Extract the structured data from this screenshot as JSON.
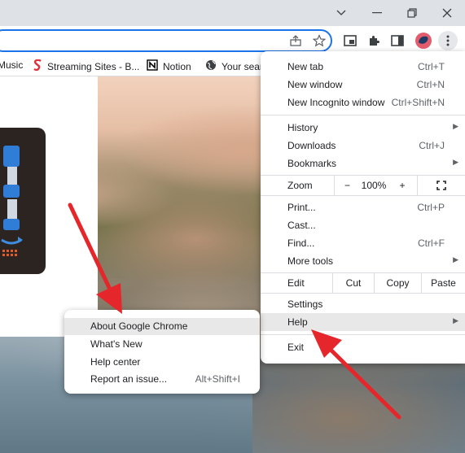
{
  "titlebar": {
    "chevron": "chevron-down-icon",
    "minimize": "minimize-icon",
    "restore": "restore-icon",
    "close": "close-icon"
  },
  "toolbar": {
    "share_icon": "share-icon",
    "star_icon": "star-icon",
    "pip_icon": "picture-in-picture-icon",
    "extensions_icon": "puzzle-icon",
    "sidepanel_icon": "side-panel-icon",
    "profile_icon": "profile-avatar-icon",
    "menu_icon": "three-dots-icon"
  },
  "bookmarks": [
    {
      "label": "Music",
      "icon": ""
    },
    {
      "label": "Streaming Sites - B...",
      "icon": "s-logo-icon"
    },
    {
      "label": "Notion",
      "icon": "notion-icon"
    },
    {
      "label": "Your sear",
      "icon": "globe-icon"
    }
  ],
  "menu": {
    "new_tab": {
      "label": "New tab",
      "shortcut": "Ctrl+T"
    },
    "new_window": {
      "label": "New window",
      "shortcut": "Ctrl+N"
    },
    "new_incognito": {
      "label": "New Incognito window",
      "shortcut": "Ctrl+Shift+N"
    },
    "history": {
      "label": "History"
    },
    "downloads": {
      "label": "Downloads",
      "shortcut": "Ctrl+J"
    },
    "bookmarks": {
      "label": "Bookmarks"
    },
    "zoom": {
      "label": "Zoom",
      "minus": "−",
      "value": "100%",
      "plus": "+",
      "fullscreen_icon": "fullscreen-icon"
    },
    "print": {
      "label": "Print...",
      "shortcut": "Ctrl+P"
    },
    "cast": {
      "label": "Cast..."
    },
    "find": {
      "label": "Find...",
      "shortcut": "Ctrl+F"
    },
    "more_tools": {
      "label": "More tools"
    },
    "edit": {
      "label": "Edit",
      "cut": "Cut",
      "copy": "Copy",
      "paste": "Paste"
    },
    "settings": {
      "label": "Settings"
    },
    "help": {
      "label": "Help"
    },
    "exit": {
      "label": "Exit"
    }
  },
  "help_submenu": {
    "about": {
      "label": "About Google Chrome"
    },
    "whats_new": {
      "label": "What's New"
    },
    "help_center": {
      "label": "Help center"
    },
    "report_issue": {
      "label": "Report an issue...",
      "shortcut": "Alt+Shift+I"
    }
  },
  "annotations": {
    "arrow_color": "#e5262a"
  }
}
